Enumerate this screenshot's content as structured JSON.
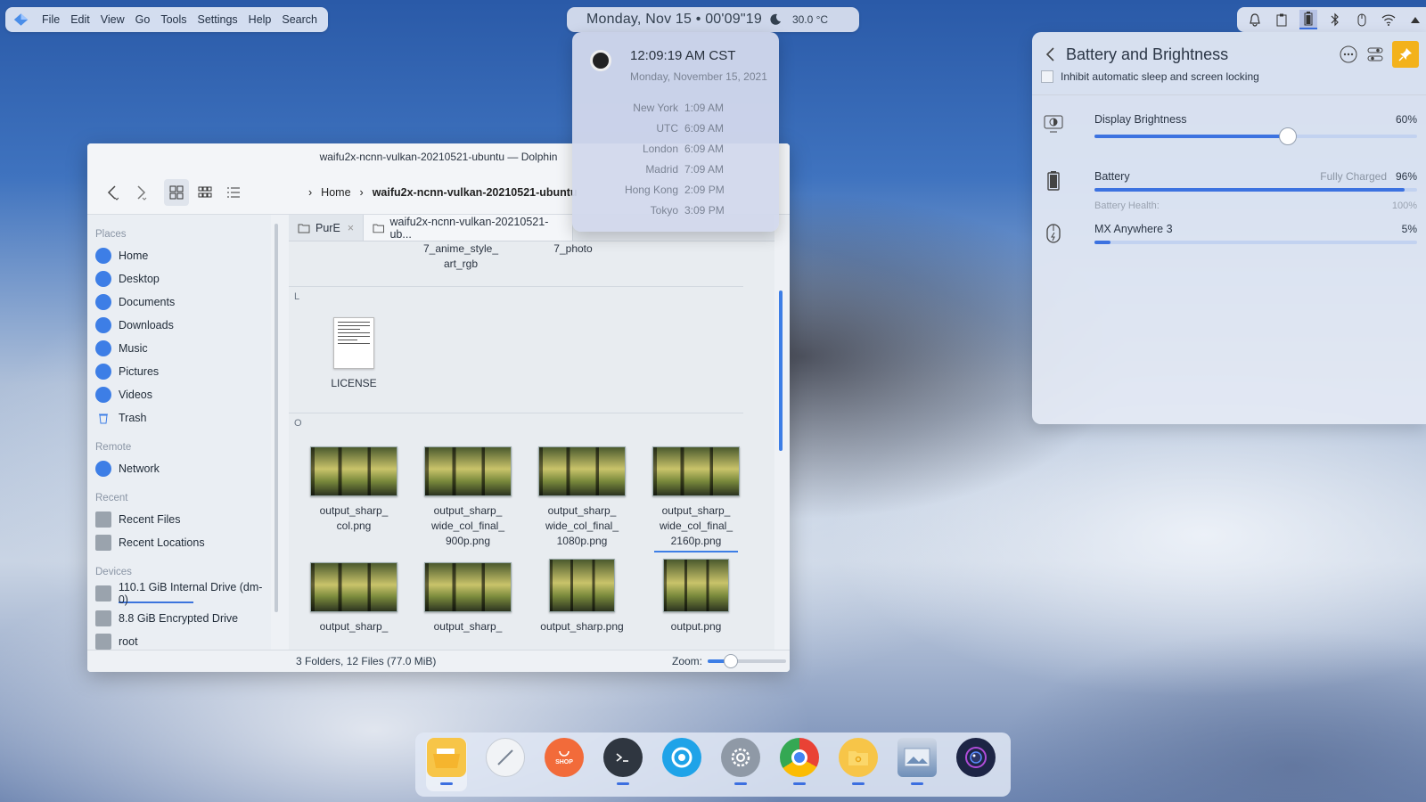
{
  "menubar": {
    "items": [
      "File",
      "Edit",
      "View",
      "Go",
      "Tools",
      "Settings",
      "Help",
      "Search"
    ]
  },
  "clockbar": {
    "date": "Monday, Nov 15 • 00'09\"19",
    "temp": "30.0 °C"
  },
  "tray": {
    "icons": [
      "bell-icon",
      "clipboard-icon",
      "battery-icon",
      "bluetooth-icon",
      "mouse-icon",
      "wifi-icon",
      "up-arrow-icon"
    ]
  },
  "dolphin": {
    "title": "waifu2x-ncnn-vulkan-20210521-ubuntu — Dolphin",
    "breadcrumb": [
      "Home",
      "waifu2x-ncnn-vulkan-20210521-ubuntu"
    ],
    "sidebar": {
      "places_heading": "Places",
      "places": [
        "Home",
        "Desktop",
        "Documents",
        "Downloads",
        "Music",
        "Pictures",
        "Videos",
        "Trash"
      ],
      "remote_heading": "Remote",
      "remote": [
        "Network"
      ],
      "recent_heading": "Recent",
      "recent": [
        "Recent Files",
        "Recent Locations"
      ],
      "devices_heading": "Devices",
      "devices": [
        "110.1 GiB Internal Drive (dm-0)",
        "8.8 GiB Encrypted Drive",
        "root"
      ]
    },
    "tabs": [
      "PurE",
      "waifu2x-ncnn-vulkan-20210521-ub..."
    ],
    "partial_files": [
      "7_anime_style_\nart_rgb",
      "7_photo"
    ],
    "section_L": "L",
    "section_O": "O",
    "license_label": "LICENSE",
    "license_text": "The MIT License (MIT) Copyright (c) 2019 nihui Permission is hereby granted, free of charge, to any person obtaining a copy of this software and associated documentation files (the",
    "files_row1": [
      "output_sharp_\ncol.png",
      "output_sharp_\nwide_col_final_\n900p.png",
      "output_sharp_\nwide_col_final_\n1080p.png",
      "output_sharp_\nwide_col_final_\n2160p.png"
    ],
    "files_row2": [
      "output_sharp_",
      "output_sharp_",
      "output_sharp.png",
      "output.png"
    ],
    "status": "3 Folders, 12 Files (77.0 MiB)",
    "zoom_label": "Zoom:",
    "zoom_level": 0.3
  },
  "clockpopup": {
    "time": "12:09:19 AM CST",
    "date": "Monday, November 15, 2021",
    "zones": [
      {
        "name": "New York",
        "time": "1:09 AM"
      },
      {
        "name": "UTC",
        "time": "6:09 AM"
      },
      {
        "name": "London",
        "time": "6:09 AM"
      },
      {
        "name": "Madrid",
        "time": "7:09 AM"
      },
      {
        "name": "Hong Kong",
        "time": "2:09 PM"
      },
      {
        "name": "Tokyo",
        "time": "3:09 PM"
      }
    ]
  },
  "battery": {
    "title": "Battery and Brightness",
    "inhibit": "Inhibit automatic sleep and screen locking",
    "brightness_label": "Display Brightness",
    "brightness_pct": "60%",
    "brightness_value": 0.6,
    "battery_label": "Battery",
    "battery_status": "Fully Charged",
    "battery_pct": "96%",
    "battery_value": 0.96,
    "health_label": "Battery Health:",
    "health_value": "100%",
    "mouse_label": "MX Anywhere 3",
    "mouse_pct": "5%",
    "mouse_value": 0.05,
    "accent": "#3c72e0"
  },
  "dock": {
    "apps": [
      "file-manager-icon",
      "text-editor-icon",
      "shop-icon",
      "terminal-icon",
      "browser-icon",
      "settings-icon",
      "chrome-icon",
      "files-icon",
      "photos-icon",
      "camera-icon"
    ],
    "shop_label": "SHOP"
  }
}
